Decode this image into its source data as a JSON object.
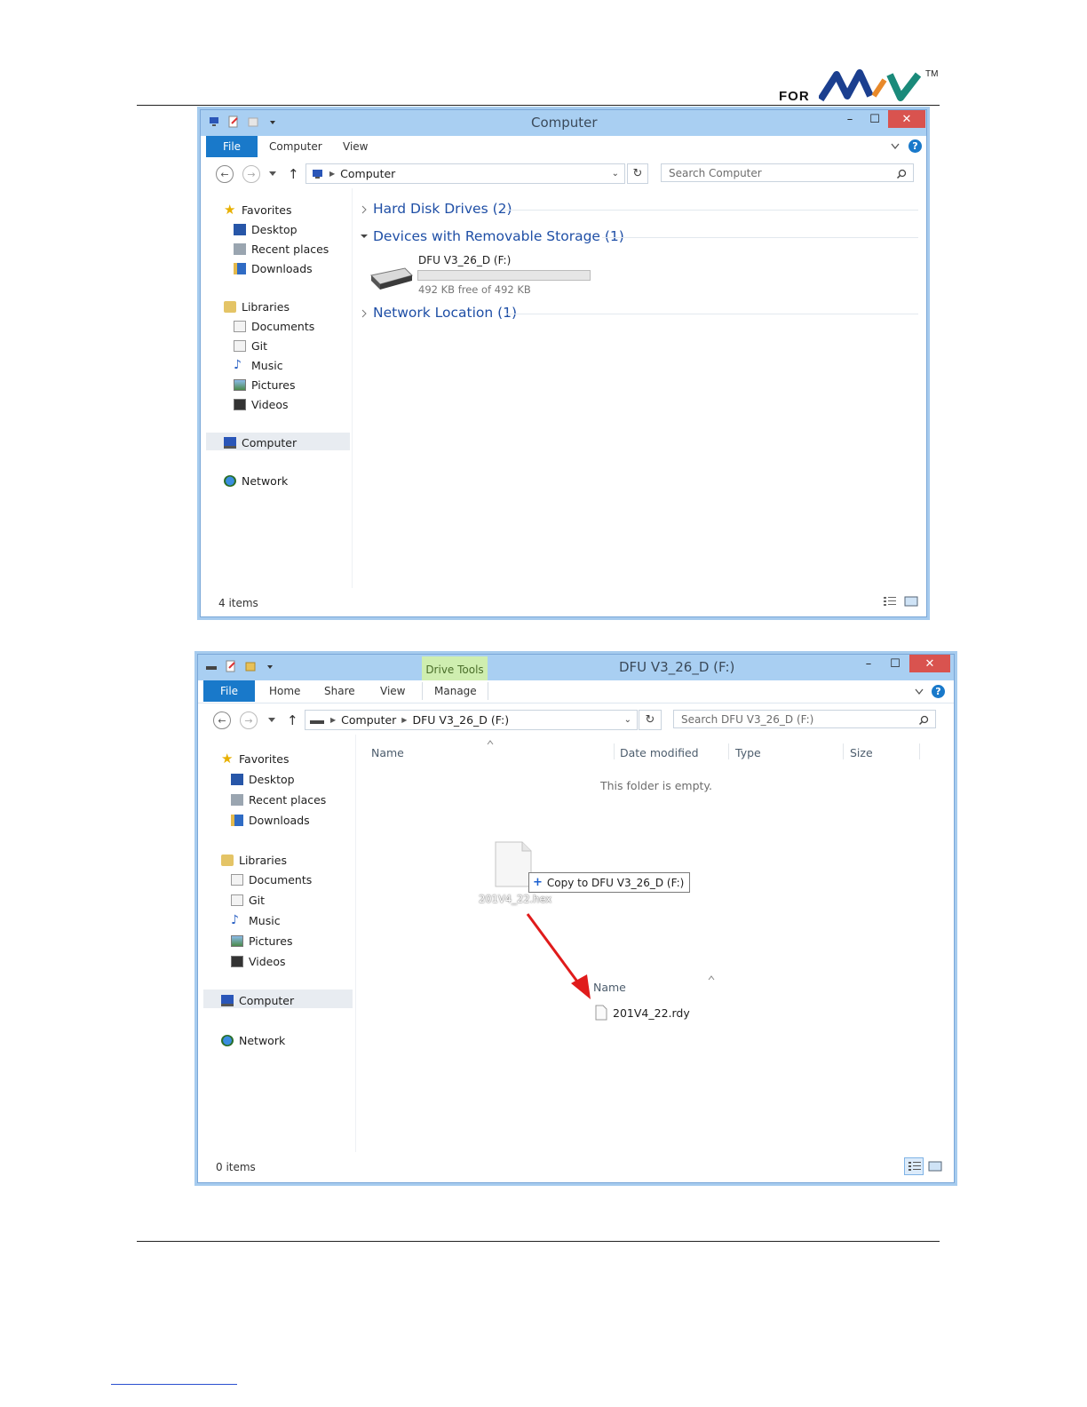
{
  "header": {
    "logo_prefix": "FOR",
    "trademark": "TM"
  },
  "window1": {
    "title": "Computer",
    "tabs": [
      "File",
      "Computer",
      "View"
    ],
    "address": {
      "crumbs": [
        "Computer"
      ]
    },
    "search_placeholder": "Search Computer",
    "nav": {
      "favorites": "Favorites",
      "favorites_items": [
        "Desktop",
        "Recent places",
        "Downloads"
      ],
      "libraries": "Libraries",
      "libraries_items": [
        "Documents",
        "Git",
        "Music",
        "Pictures",
        "Videos"
      ],
      "computer": "Computer",
      "network": "Network"
    },
    "sections": [
      "Hard Disk Drives (2)",
      "Devices with Removable Storage (1)",
      "Network Location (1)"
    ],
    "drive": {
      "name": "DFU V3_26_D (F:)",
      "free_text": "492 KB free of 492 KB",
      "used_fraction": 0.0
    },
    "status": "4 items"
  },
  "window2": {
    "title": "DFU V3_26_D (F:)",
    "context_tab": "Drive Tools",
    "tabs": [
      "File",
      "Home",
      "Share",
      "View",
      "Manage"
    ],
    "address": {
      "crumbs": [
        "Computer",
        "DFU V3_26_D (F:)"
      ]
    },
    "search_placeholder": "Search DFU V3_26_D (F:)",
    "nav": {
      "favorites": "Favorites",
      "favorites_items": [
        "Desktop",
        "Recent places",
        "Downloads"
      ],
      "libraries": "Libraries",
      "libraries_items": [
        "Documents",
        "Git",
        "Music",
        "Pictures",
        "Videos"
      ],
      "computer": "Computer",
      "network": "Network"
    },
    "columns": [
      "Name",
      "Date modified",
      "Type",
      "Size"
    ],
    "empty_text": "This folder is empty.",
    "drag_file": "201V4_22.hex",
    "copy_tooltip": "Copy to DFU V3_26_D (F:)",
    "result_header": "Name",
    "result_file": "201V4_22.rdy",
    "status": "0 items"
  },
  "colors": {
    "accent": "#1979ca",
    "titlebar": "#a9cff2",
    "close": "#d9534f",
    "arrow": "#e01b1b",
    "logo_dark": "#1b3f8f",
    "logo_teal": "#1a8a7a"
  }
}
